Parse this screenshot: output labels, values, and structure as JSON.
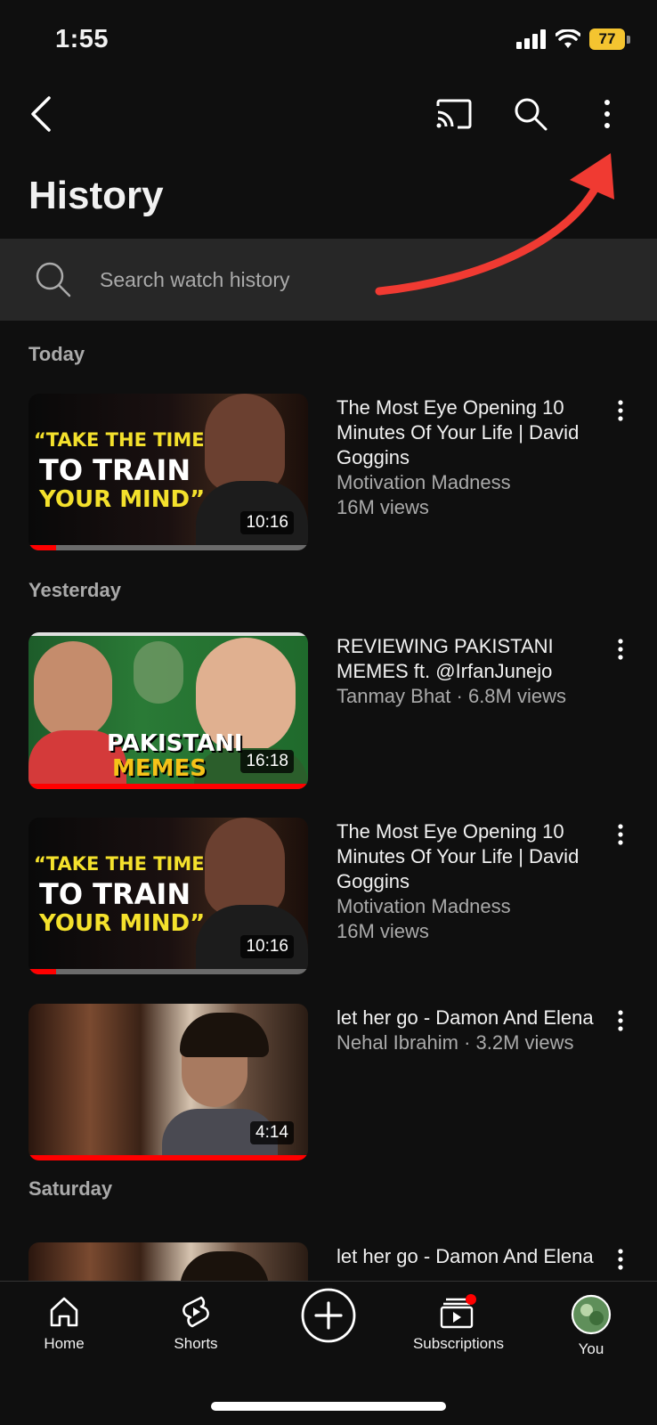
{
  "status_bar": {
    "time": "1:55",
    "battery": "77"
  },
  "header": {
    "title": "History"
  },
  "search": {
    "placeholder": "Search watch history"
  },
  "icons": {
    "back": "back-arrow-icon",
    "cast": "cast-icon",
    "search": "search-icon",
    "more": "more-vert-icon",
    "annotation": "red-curved-arrow"
  },
  "colors": {
    "background": "#0f0f0f",
    "accent": "#ff0000",
    "annotation": "#f03a32",
    "search_bg": "#272727"
  },
  "sections": [
    {
      "label": "Today"
    },
    {
      "label": "Yesterday"
    },
    {
      "label": "Saturday"
    }
  ],
  "videos": [
    {
      "title": "The Most Eye Opening 10 Minutes Of Your Life | David Goggins",
      "line1": "Motivation Madness",
      "line2": "16M views",
      "duration": "10:16",
      "progress": 0.1,
      "thumb_text": [
        "“TAKE THE TIME",
        "TO TRAIN",
        "YOUR MIND”"
      ]
    },
    {
      "title": "REVIEWING PAKISTANI MEMES  ft. @IrfanJunejo",
      "line1": "Tanmay Bhat · 6.8M views",
      "duration": "16:18",
      "progress": 1.0,
      "thumb_text": [
        "PAKISTANI",
        "MEMES"
      ]
    },
    {
      "title": "The Most Eye Opening 10 Minutes Of Your Life | David Goggins",
      "line1": "Motivation Madness",
      "line2": "16M views",
      "duration": "10:16",
      "progress": 0.1,
      "thumb_text": [
        "“TAKE THE TIME",
        "TO TRAIN",
        "YOUR MIND”"
      ]
    },
    {
      "title": "let her go - Damon And Elena",
      "line1": "Nehal Ibrahim · 3.2M views",
      "duration": "4:14",
      "progress": 1.0
    },
    {
      "title": "let her go - Damon And Elena"
    }
  ],
  "bottom_nav": [
    {
      "label": "Home",
      "icon": "home-icon"
    },
    {
      "label": "Shorts",
      "icon": "shorts-icon"
    },
    {
      "label": "",
      "icon": "create-plus-icon"
    },
    {
      "label": "Subscriptions",
      "icon": "subscriptions-icon"
    },
    {
      "label": "You",
      "icon": "avatar"
    }
  ]
}
